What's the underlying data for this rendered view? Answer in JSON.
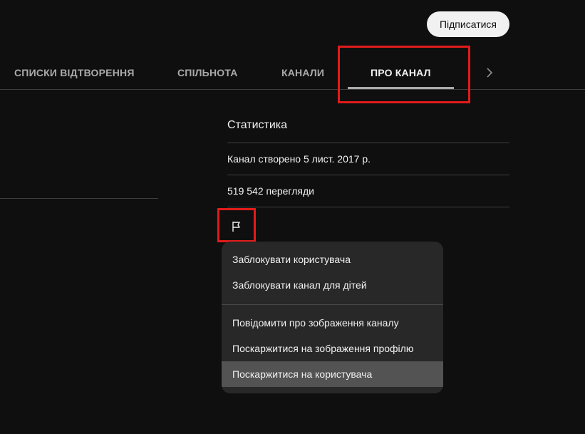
{
  "header": {
    "subscribe_label": "Підписатися"
  },
  "tabs": {
    "items": [
      {
        "label": "СПИСКИ ВІДТВОРЕННЯ"
      },
      {
        "label": "СПІЛЬНОТА"
      },
      {
        "label": "КАНАЛИ"
      },
      {
        "label": "ПРО КАНАЛ",
        "active": true
      }
    ],
    "next_icon": "chevron-right-icon"
  },
  "stats": {
    "title": "Статистика",
    "created": "Канал створено 5 лист. 2017 р.",
    "views": "519 542 перегляди",
    "report_icon": "flag-icon"
  },
  "menu": {
    "items": [
      {
        "label": "Заблокувати користувача"
      },
      {
        "label": "Заблокувати канал для дітей"
      },
      {
        "label": "Повідомити про зображення каналу"
      },
      {
        "label": "Поскаржитися на зображення профілю"
      },
      {
        "label": "Поскаржитися на користувача",
        "hovered": true
      }
    ]
  },
  "colors": {
    "background": "#0f0f0f",
    "highlight": "#e21b1b",
    "menu_background": "#282828",
    "menu_hover": "#535353"
  }
}
